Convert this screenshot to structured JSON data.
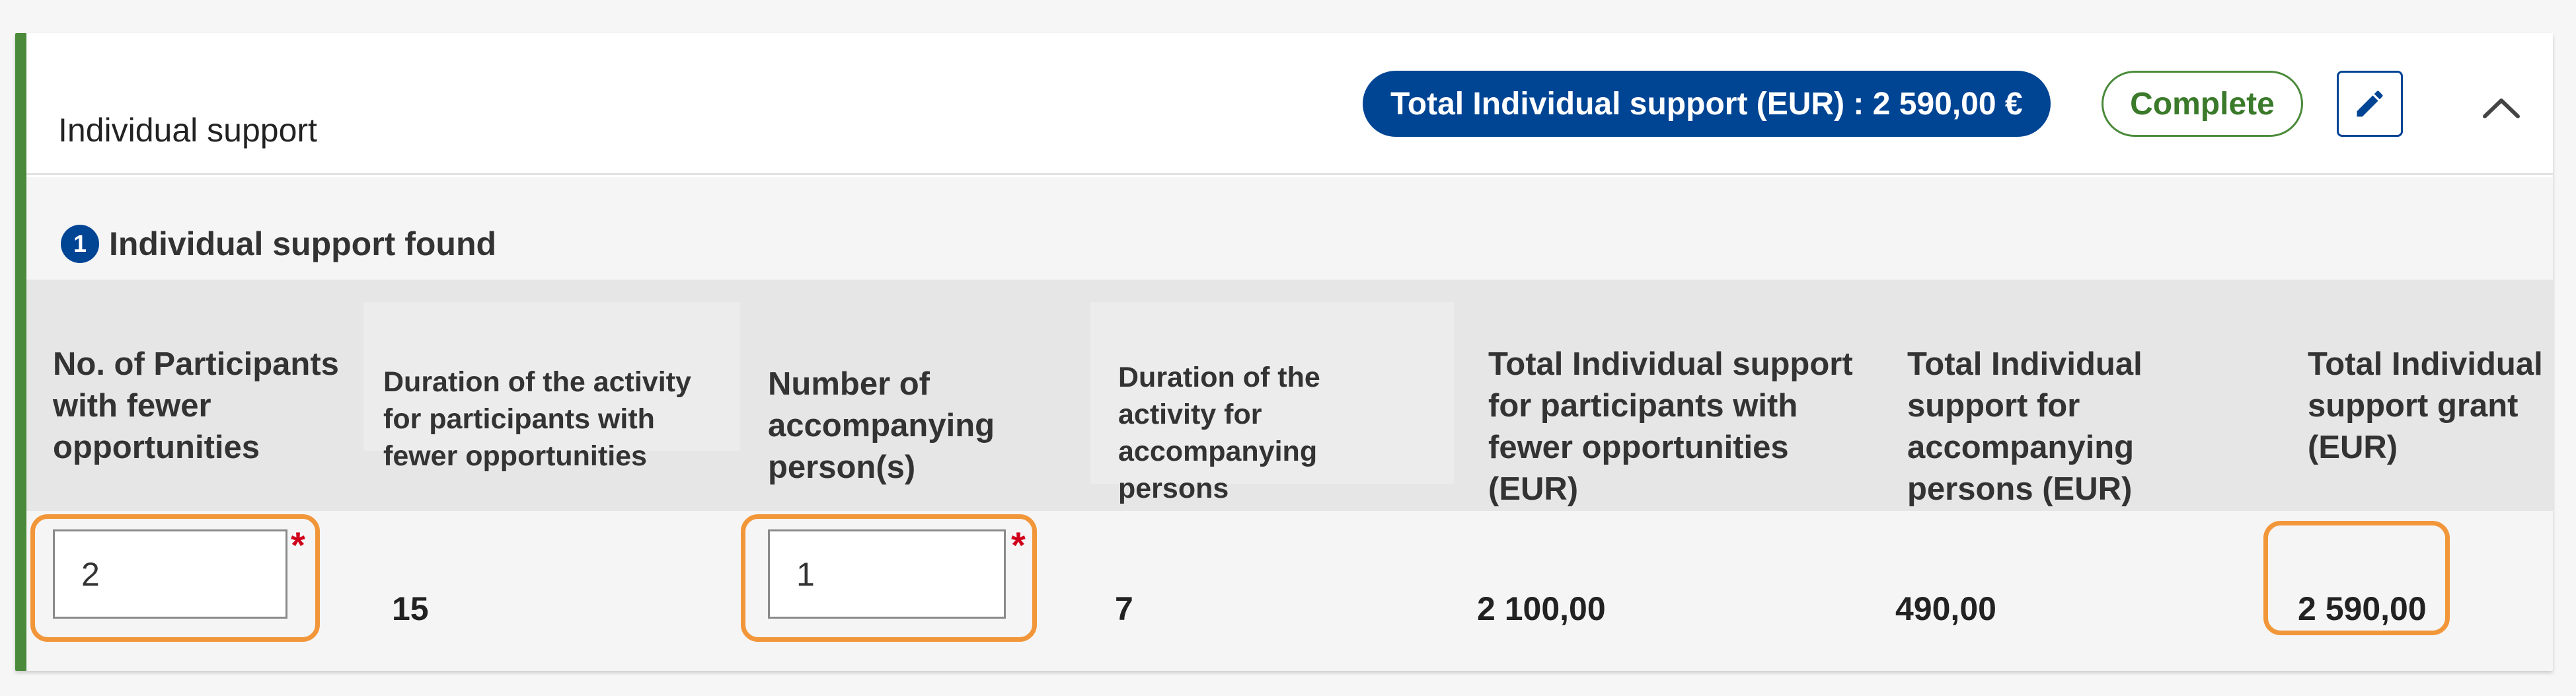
{
  "section": {
    "title": "Individual support",
    "total_label": "Total Individual support (EUR) : 2 590,00 €",
    "status": "Complete",
    "icons": {
      "edit": "pencil-icon",
      "collapse": "chevron-up-icon"
    },
    "colors": {
      "accent": "#004494",
      "complete": "#4a8a3a",
      "highlight": "#f2963a",
      "required": "#d0021b"
    }
  },
  "found": {
    "count": "1",
    "label": "Individual support found"
  },
  "table": {
    "headers": [
      "No. of Participants with fewer opportunities",
      "Duration of the activity for participants with fewer opportunities",
      "Number of accompanying person(s)",
      "Duration of the activity for accompanying persons",
      "Total Individual support for participants with fewer opportunities (EUR)",
      "Total Individual support for accompanying persons (EUR)",
      "Total Individual support grant (EUR)"
    ],
    "row": {
      "participants": "2",
      "duration_participants": "15",
      "accompanying": "1",
      "duration_accompanying": "7",
      "total_participants": "2 100,00",
      "total_accompanying": "490,00",
      "total_grant": "2 590,00"
    },
    "required_mark": "*"
  }
}
